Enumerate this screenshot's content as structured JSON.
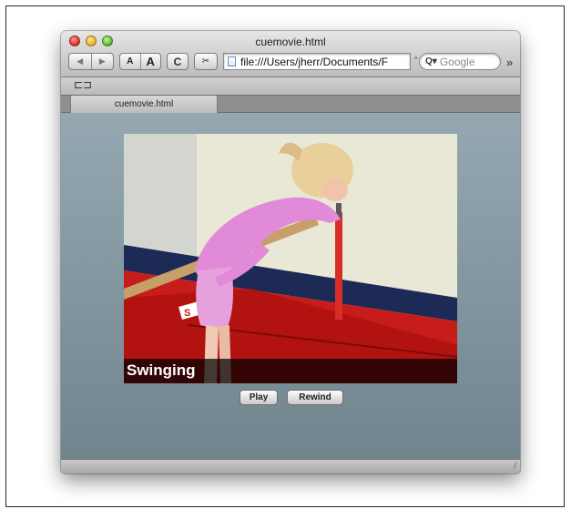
{
  "window": {
    "title": "cuemovie.html"
  },
  "toolbar": {
    "back_label": "◀",
    "forward_label": "▶",
    "text_smaller_label": "A",
    "text_bigger_label": "A",
    "reload_label": "C",
    "snip_label": "✂",
    "address_value": "file:///Users/jherr/Documents/F",
    "address_stepper": "⌃",
    "search_icon": "Q▾",
    "search_placeholder": "Google",
    "overflow_label": "»"
  },
  "bookmarks": {
    "icon_label": "⊏⊐"
  },
  "tabs": [
    {
      "label": "cuemovie.html"
    }
  ],
  "video": {
    "caption": "Swinging"
  },
  "controls": {
    "play_label": "Play",
    "rewind_label": "Rewind"
  },
  "statusbar": {
    "grip_label": "⫽"
  }
}
